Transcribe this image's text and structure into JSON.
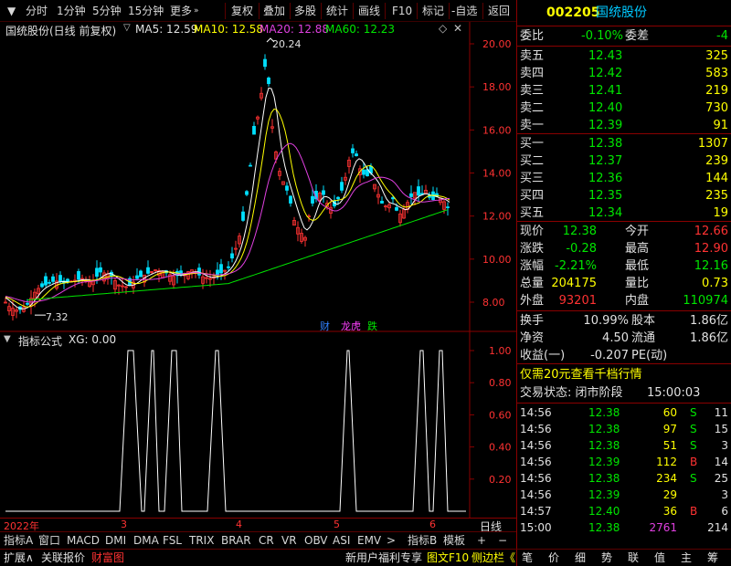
{
  "toolbar": {
    "items": [
      "分时",
      "1分钟",
      "5分钟",
      "15分钟",
      "更多",
      "复权",
      "叠加",
      "多股",
      "统计",
      "画线",
      "F10",
      "标记",
      "-自选",
      "返回"
    ]
  },
  "main_chart": {
    "title": "国统股份(日线 前复权)",
    "ma5": "MA5: 12.59",
    "ma10": "MA10: 12.58",
    "ma20": "MA20: 12.88",
    "ma60": "MA60: 12.23",
    "high_label": "20.24",
    "low_label": "7.32",
    "y_ticks": [
      "20.00",
      "18.00",
      "16.00",
      "14.00",
      "12.00",
      "10.00",
      "8.00"
    ],
    "badges": [
      "财",
      "龙虎",
      "跌"
    ]
  },
  "indicator": {
    "title": "指标公式",
    "xg": "XG: 0.00",
    "y_ticks": [
      "1.00",
      "0.80",
      "0.60",
      "0.40",
      "0.20"
    ]
  },
  "x_axis": {
    "labels": [
      "2022年",
      "3",
      "4",
      "5",
      "6"
    ],
    "right_label": "日线"
  },
  "bottom_tabs": [
    "指标A",
    "窗口",
    "MACD",
    "DMI",
    "DMA",
    "FSL",
    "TRIX",
    "BRAR",
    "CR",
    "VR",
    "OBV",
    "ASI",
    "EMV",
    ">",
    "指标B",
    "模板",
    "+",
    "−"
  ],
  "status_bar": {
    "left": [
      "扩展∧",
      "关联报价",
      "财富图"
    ],
    "right": [
      "新用户福利专享",
      "图文F10",
      "侧边栏《"
    ]
  },
  "quote": {
    "code": "002205",
    "name": "国统股份",
    "weibi_label": "委比",
    "weibi": "-0.10%",
    "weicha_label": "委差",
    "weicha": "-4",
    "asks": [
      {
        "label": "卖五",
        "price": "12.43",
        "vol": "325"
      },
      {
        "label": "卖四",
        "price": "12.42",
        "vol": "583"
      },
      {
        "label": "卖三",
        "price": "12.41",
        "vol": "219"
      },
      {
        "label": "卖二",
        "price": "12.40",
        "vol": "730"
      },
      {
        "label": "卖一",
        "price": "12.39",
        "vol": "91"
      }
    ],
    "bids": [
      {
        "label": "买一",
        "price": "12.38",
        "vol": "1307"
      },
      {
        "label": "买二",
        "price": "12.37",
        "vol": "239"
      },
      {
        "label": "买三",
        "price": "12.36",
        "vol": "144"
      },
      {
        "label": "买四",
        "price": "12.35",
        "vol": "235"
      },
      {
        "label": "买五",
        "price": "12.34",
        "vol": "19"
      }
    ],
    "stats": [
      {
        "l1": "现价",
        "v1": "12.38",
        "l2": "今开",
        "v2": "12.66"
      },
      {
        "l1": "涨跌",
        "v1": "-0.28",
        "l2": "最高",
        "v2": "12.90"
      },
      {
        "l1": "涨幅",
        "v1": "-2.21%",
        "l2": "最低",
        "v2": "12.16"
      },
      {
        "l1": "总量",
        "v1": "204175",
        "l2": "量比",
        "v2": "0.73"
      },
      {
        "l1": "外盘",
        "v1": "93201",
        "l2": "内盘",
        "v2": "110974"
      }
    ],
    "stats2": [
      {
        "l1": "换手",
        "v1": "10.99%",
        "l2": "股本",
        "v2": "1.86亿"
      },
      {
        "l1": "净资",
        "v1": "4.50",
        "l2": "流通",
        "v2": "1.86亿"
      },
      {
        "l1": "收益(一)",
        "v1": "-0.207",
        "l2": "PE(动)",
        "v2": ""
      }
    ],
    "promo": "仅需20元查看千档行情",
    "trade_status_label": "交易状态: 闭市阶段",
    "trade_status_time": "15:00:03",
    "ticks": [
      {
        "t": "14:56",
        "p": "12.38",
        "v": "60",
        "bs": "S",
        "n": "11"
      },
      {
        "t": "14:56",
        "p": "12.38",
        "v": "97",
        "bs": "S",
        "n": "15"
      },
      {
        "t": "14:56",
        "p": "12.38",
        "v": "51",
        "bs": "S",
        "n": "3"
      },
      {
        "t": "14:56",
        "p": "12.39",
        "v": "112",
        "bs": "B",
        "n": "14"
      },
      {
        "t": "14:56",
        "p": "12.38",
        "v": "234",
        "bs": "S",
        "n": "25"
      },
      {
        "t": "14:56",
        "p": "12.39",
        "v": "29",
        "bs": "",
        "n": "3"
      },
      {
        "t": "14:57",
        "p": "12.40",
        "v": "36",
        "bs": "B",
        "n": "6"
      },
      {
        "t": "15:00",
        "p": "12.38",
        "v": "2761",
        "bs": "",
        "n": "214"
      }
    ],
    "bottom_tabs": [
      "笔",
      "价",
      "细",
      "势",
      "联",
      "值",
      "主",
      "筹"
    ]
  }
}
